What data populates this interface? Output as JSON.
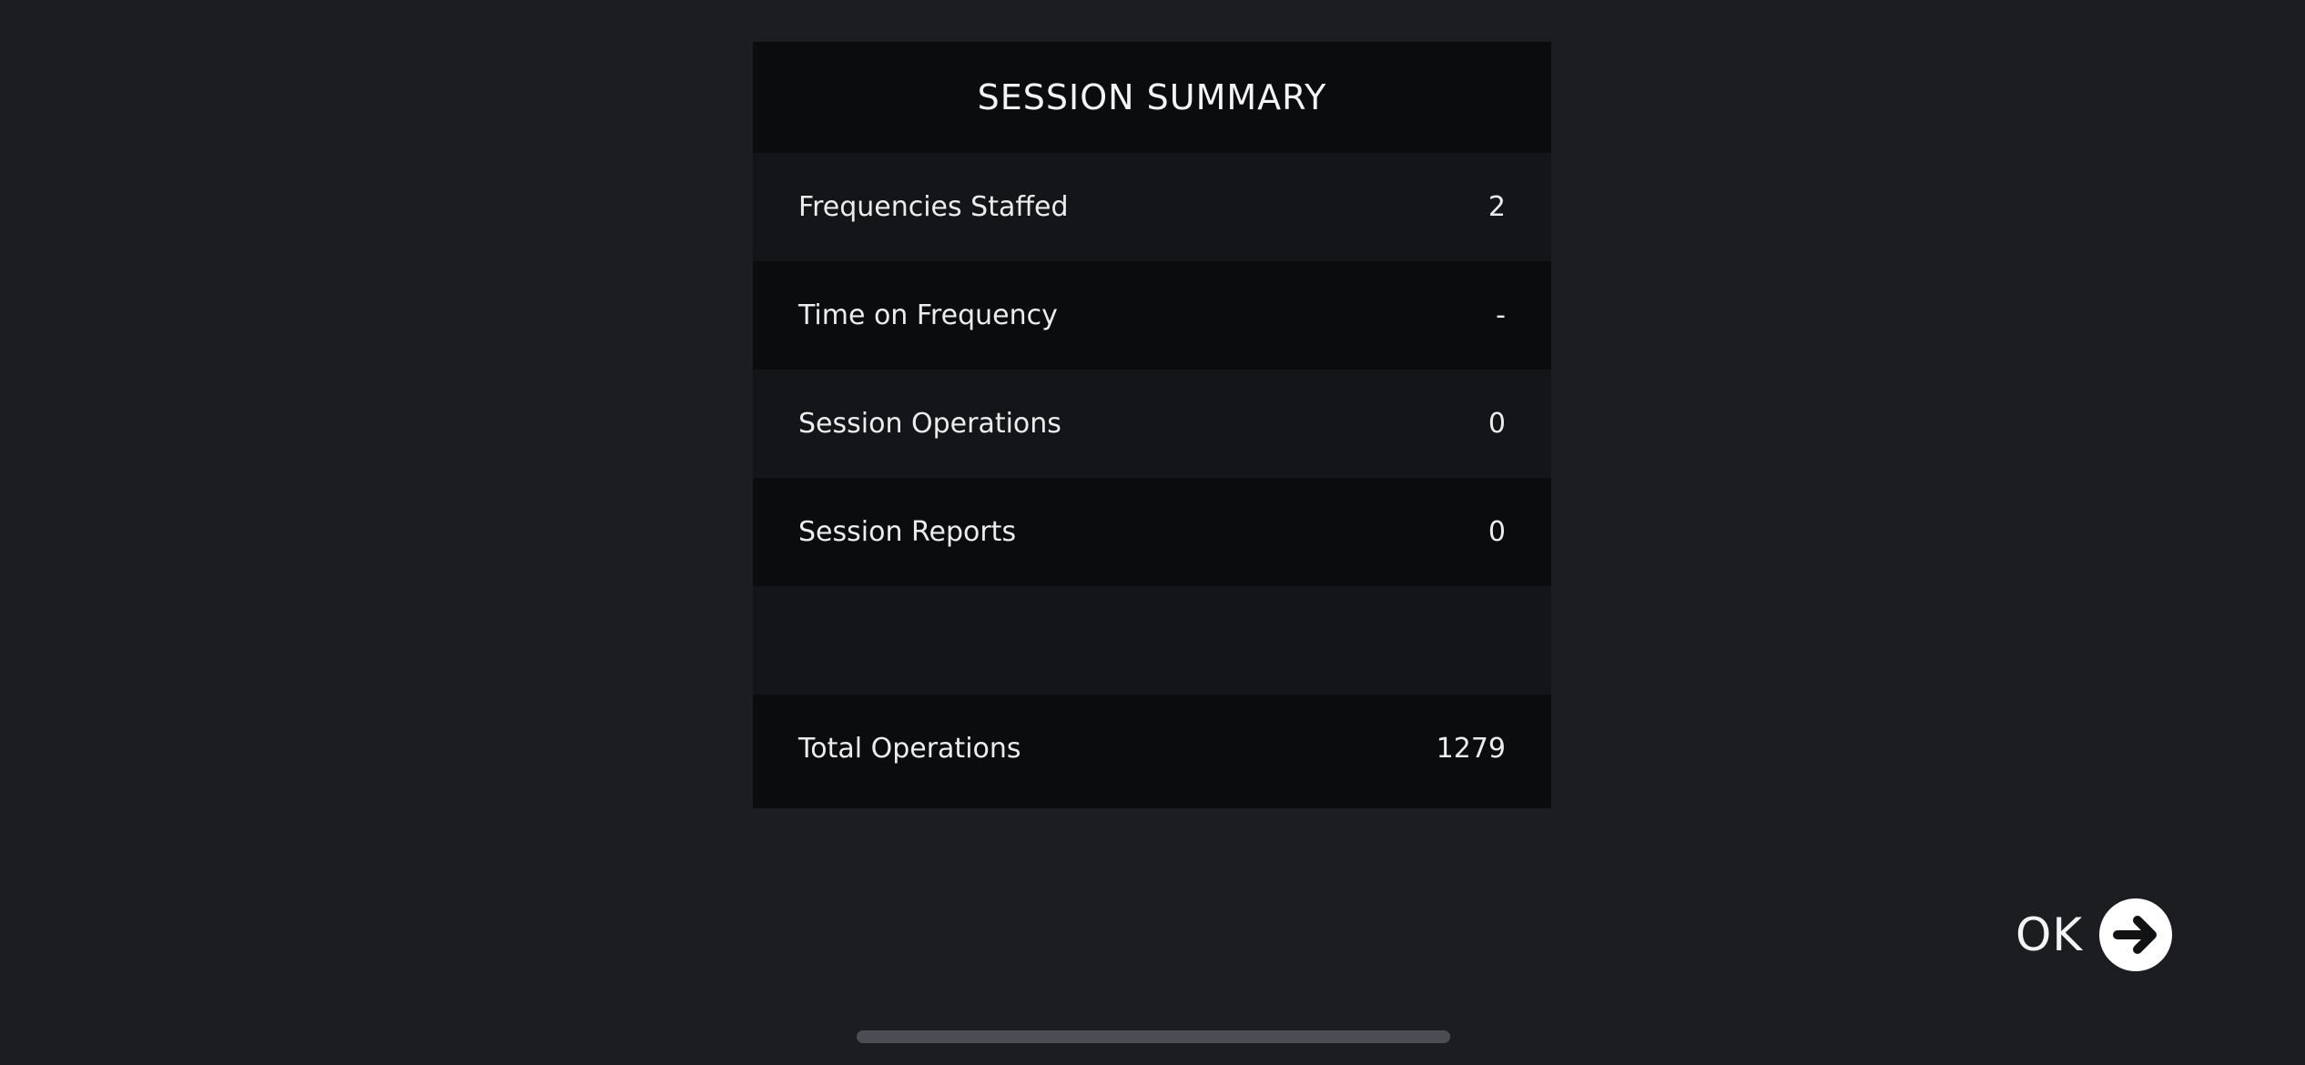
{
  "summary": {
    "title": "SESSION SUMMARY",
    "rows": [
      {
        "label": "Frequencies Staffed",
        "value": "2"
      },
      {
        "label": "Time on Frequency",
        "value": "-"
      },
      {
        "label": "Session Operations",
        "value": "0"
      },
      {
        "label": "Session Reports",
        "value": "0"
      }
    ],
    "total": {
      "label": "Total Operations",
      "value": "1279"
    }
  },
  "ok_button": {
    "label": "OK",
    "icon": "arrow-right-circle-icon"
  },
  "colors": {
    "background": "#1b1d21",
    "panel_dark": "#0b0c0e",
    "panel_light": "#141518",
    "text": "#f2f2f2",
    "button_circle": "#ffffff"
  }
}
